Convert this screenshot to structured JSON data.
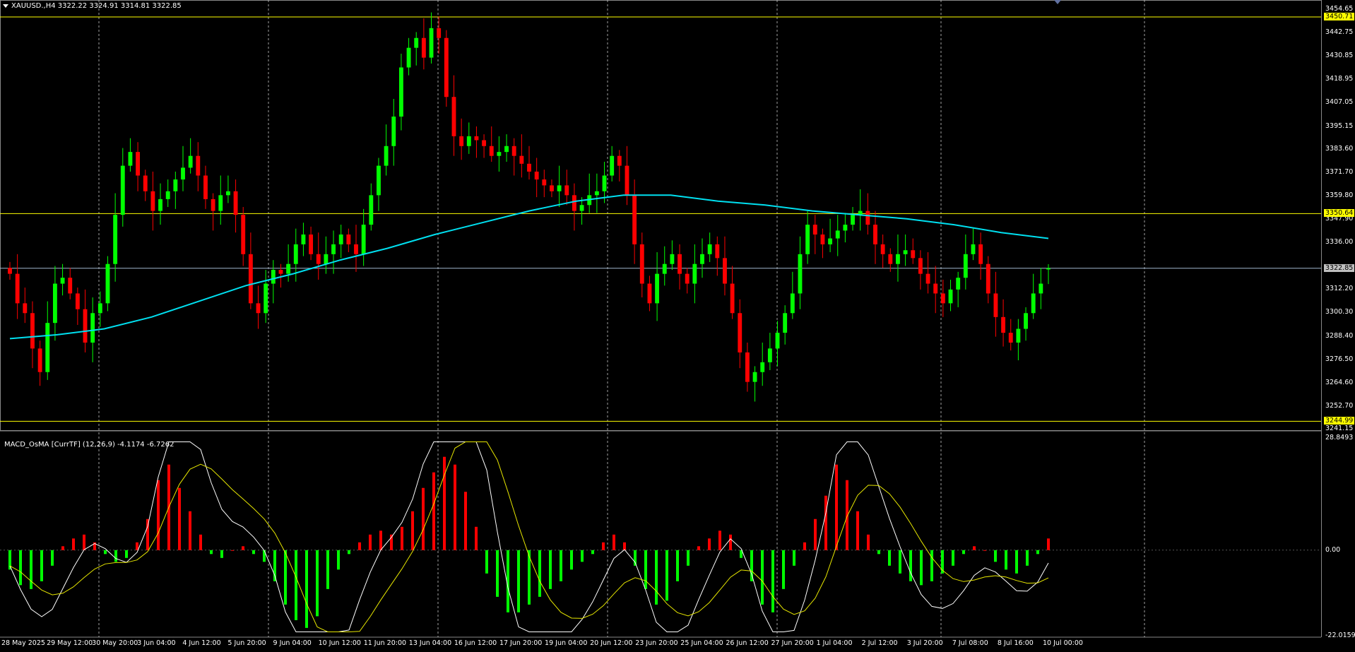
{
  "header": {
    "symbol_line": "XAUUSD.,H4  3322.22 3324.91 3314.81 3322.85"
  },
  "indicator": {
    "label": "MACD_OsMA [CurrTF] (12,26,9) -4.1174 -6.7262"
  },
  "price_axis": {
    "ticks": [
      "3454.65",
      "3442.75",
      "3430.85",
      "3418.95",
      "3407.05",
      "3395.15",
      "3383.60",
      "3371.70",
      "3359.80",
      "3347.90",
      "3336.00",
      "3312.20",
      "3300.30",
      "3288.40",
      "3276.50",
      "3264.60",
      "3252.70",
      "3241.15"
    ],
    "levels": [
      {
        "value": "3450.71",
        "style": "yellow"
      },
      {
        "value": "3350.64",
        "style": "yellow"
      },
      {
        "value": "3322.85",
        "style": "gray"
      },
      {
        "value": "3244.99",
        "style": "yellow"
      }
    ]
  },
  "indicator_axis": {
    "ticks": [
      "28.8493",
      "0.00",
      "-22.0159"
    ]
  },
  "time_axis": {
    "labels": [
      "28 May 2025",
      "29 May 12:00",
      "30 May 20:00",
      "3 Jun 04:00",
      "4 Jun 12:00",
      "5 Jun 20:00",
      "9 Jun 04:00",
      "10 Jun 12:00",
      "11 Jun 20:00",
      "13 Jun 04:00",
      "16 Jun 12:00",
      "17 Jun 20:00",
      "19 Jun 04:00",
      "20 Jun 12:00",
      "23 Jun 20:00",
      "25 Jun 04:00",
      "26 Jun 12:00",
      "27 Jun 20:00",
      "1 Jul 04:00",
      "2 Jul 12:00",
      "3 Jul 20:00",
      "7 Jul 08:00",
      "8 Jul 16:00",
      "10 Jul 00:00"
    ]
  },
  "colors": {
    "bull": "#00ff00",
    "bear": "#ff0000",
    "ma": "#00e0f0",
    "level": "#ffff00",
    "current": "#9fb6cd",
    "grid": "#c8c8c8",
    "macd_main": "#ffffff",
    "macd_signal": "#e6e600"
  },
  "chart_data": [
    {
      "type": "candlestick",
      "symbol": "XAUUSD.",
      "timeframe": "H4",
      "ylim": [
        3241.15,
        3454.65
      ],
      "ohlc_last": {
        "open": 3322.22,
        "high": 3324.91,
        "low": 3314.81,
        "close": 3322.85
      },
      "close_path": [
        3320,
        3305,
        3300,
        3282,
        3270,
        3295,
        3315,
        3318,
        3310,
        3302,
        3285,
        3300,
        3305,
        3325,
        3350,
        3375,
        3382,
        3370,
        3362,
        3352,
        3358,
        3362,
        3368,
        3374,
        3380,
        3370,
        3358,
        3352,
        3360,
        3362,
        3350,
        3330,
        3305,
        3300,
        3315,
        3322,
        3320,
        3325,
        3335,
        3340,
        3330,
        3325,
        3330,
        3335,
        3340,
        3335,
        3330,
        3345,
        3360,
        3375,
        3385,
        3400,
        3425,
        3435,
        3440,
        3430,
        3445,
        3440,
        3410,
        3390,
        3385,
        3390,
        3388,
        3385,
        3380,
        3382,
        3385,
        3380,
        3376,
        3372,
        3368,
        3365,
        3362,
        3365,
        3360,
        3352,
        3355,
        3360,
        3362,
        3370,
        3380,
        3375,
        3360,
        3335,
        3315,
        3305,
        3320,
        3325,
        3330,
        3320,
        3315,
        3325,
        3330,
        3335,
        3328,
        3315,
        3300,
        3280,
        3265,
        3270,
        3275,
        3282,
        3290,
        3300,
        3310,
        3330,
        3345,
        3340,
        3335,
        3338,
        3342,
        3345,
        3350,
        3352,
        3345,
        3335,
        3330,
        3325,
        3330,
        3332,
        3328,
        3320,
        3315,
        3310,
        3305,
        3312,
        3318,
        3330,
        3335,
        3325,
        3310,
        3298,
        3290,
        3285,
        3292,
        3300,
        3310,
        3315,
        3322.85
      ]
    },
    {
      "type": "line",
      "title": "",
      "series": [
        {
          "name": "",
          "values": [
            3287,
            3289,
            3292,
            3298,
            3306,
            3314,
            3320,
            3327,
            3333,
            3340,
            3346,
            3352,
            3357,
            3360,
            3360,
            3357,
            3355,
            3352,
            3350,
            3348,
            3345,
            3341,
            3338
          ]
        }
      ],
      "ylim": [
        3241.15,
        3454.65
      ]
    },
    {
      "type": "bar",
      "title": "MACD_OsMA [CurrTF] (12,26,9) -4.1174 -6.7262",
      "ylim": [
        -22.0159,
        28.8493
      ],
      "histogram": [
        -5,
        -9,
        -10,
        -8,
        -4,
        1,
        3,
        4,
        2,
        -1,
        -3,
        -2,
        2,
        8,
        18,
        22,
        16,
        10,
        4,
        -1,
        -2,
        0,
        1,
        -1,
        -3,
        -8,
        -14,
        -18,
        -20,
        -17,
        -10,
        -5,
        -1,
        2,
        4,
        5,
        4,
        6,
        10,
        16,
        20,
        24,
        22,
        15,
        6,
        -6,
        -12,
        -16,
        -16,
        -14,
        -12,
        -10,
        -8,
        -5,
        -3,
        -1,
        2,
        4,
        2,
        -4,
        -10,
        -14,
        -13,
        -8,
        -4,
        1,
        3,
        5,
        4,
        -2,
        -8,
        -14,
        -16,
        -10,
        -4,
        2,
        8,
        14,
        22,
        18,
        10,
        4,
        -1,
        -4,
        -6,
        -8,
        -9,
        -8,
        -6,
        -4,
        -1,
        1,
        0,
        -3,
        -5,
        -6,
        -4,
        -1,
        3
      ]
    }
  ]
}
